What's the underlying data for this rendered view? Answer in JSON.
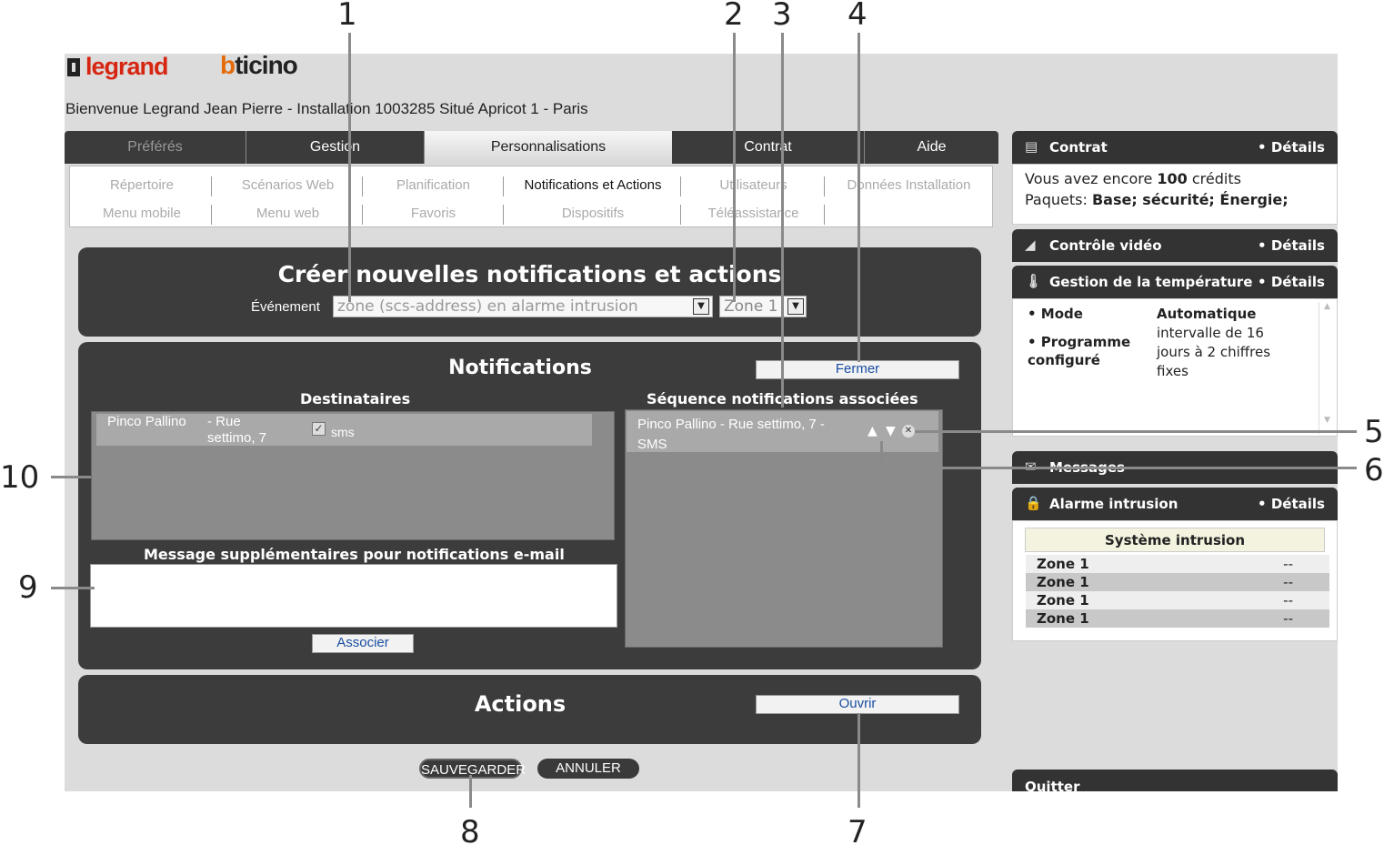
{
  "brand": {
    "legrand": "legrand",
    "bticino_b": "b",
    "bticino_rest": "ticino"
  },
  "welcome": "Bienvenue Legrand Jean Pierre - Installation 1003285 Situé Apricot 1 - Paris",
  "tabs": [
    {
      "label": "Préférés",
      "state": "muted"
    },
    {
      "label": "Gestion",
      "state": "normal"
    },
    {
      "label": "Personnalisations",
      "state": "active"
    },
    {
      "label": "Contrat",
      "state": "normal"
    },
    {
      "label": "Aide",
      "state": "normal"
    }
  ],
  "subnav": {
    "row1": [
      "Répertoire",
      "Scénarios Web",
      "Planification",
      "Notifications et Actions",
      "Utilisateurs",
      "Données Installation"
    ],
    "row2": [
      "Menu mobile",
      "Menu web",
      "Favoris",
      "Dispositifs",
      "Téléassistance"
    ],
    "active": "Notifications et Actions"
  },
  "create": {
    "title": "Créer nouvelles notifications et actions",
    "event_label": "Événement",
    "event_value": "zone (scs-address) en alarme intrusion",
    "zone_value": "Zone 1"
  },
  "notifications": {
    "title": "Notifications",
    "close_button": "Fermer",
    "recipients_header": "Destinataires",
    "recipient": {
      "name": "Pinco Pallino",
      "address": "- Rue settimo, 7",
      "channel": "sms",
      "checked": true
    },
    "sequence_header": "Séquence notifications associées",
    "sequence_item": "Pinco Pallino - Rue settimo, 7 - SMS",
    "message_label": "Message supplémentaires pour notifications e-mail",
    "message_value": "",
    "associate_button": "Associer"
  },
  "actions": {
    "title": "Actions",
    "open_button": "Ouvrir"
  },
  "footer": {
    "save": "SAUVEGARDER",
    "cancel": "ANNULER"
  },
  "sidebar": {
    "contrat": {
      "title": "Contrat",
      "details": "• Détails",
      "line1_pre": "Vous avez encore ",
      "line1_num": "100",
      "line1_post": " crédits",
      "line2_pre": "Paquets: ",
      "line2_val": "Base; sécurité; Énergie;"
    },
    "video": {
      "title": "Contrôle vidéo",
      "details": "• Détails"
    },
    "temperature": {
      "title": "Gestion de la température",
      "details": "• Détails",
      "mode_label": "• Mode",
      "mode_value": "Automatique",
      "program_label": "• Programme configuré",
      "program_value": "intervalle de 16 jours à 2 chiffres fixes"
    },
    "messages": {
      "title": "Messages"
    },
    "alarm": {
      "title": "Alarme intrusion",
      "details": "• Détails",
      "system_header": "Système intrusion",
      "zones": [
        {
          "name": "Zone 1",
          "value": "--"
        },
        {
          "name": "Zone 1",
          "value": "--"
        },
        {
          "name": "Zone 1",
          "value": "--"
        },
        {
          "name": "Zone 1",
          "value": "--"
        }
      ]
    },
    "quit": {
      "title": "Quitter"
    }
  },
  "callouts": [
    "1",
    "2",
    "3",
    "4",
    "5",
    "6",
    "7",
    "8",
    "9",
    "10"
  ],
  "colors": {
    "panel": "#3c3c3c",
    "link": "#1a4fa3",
    "legrand_red": "#d62612",
    "bticino_orange": "#e36b0b"
  }
}
